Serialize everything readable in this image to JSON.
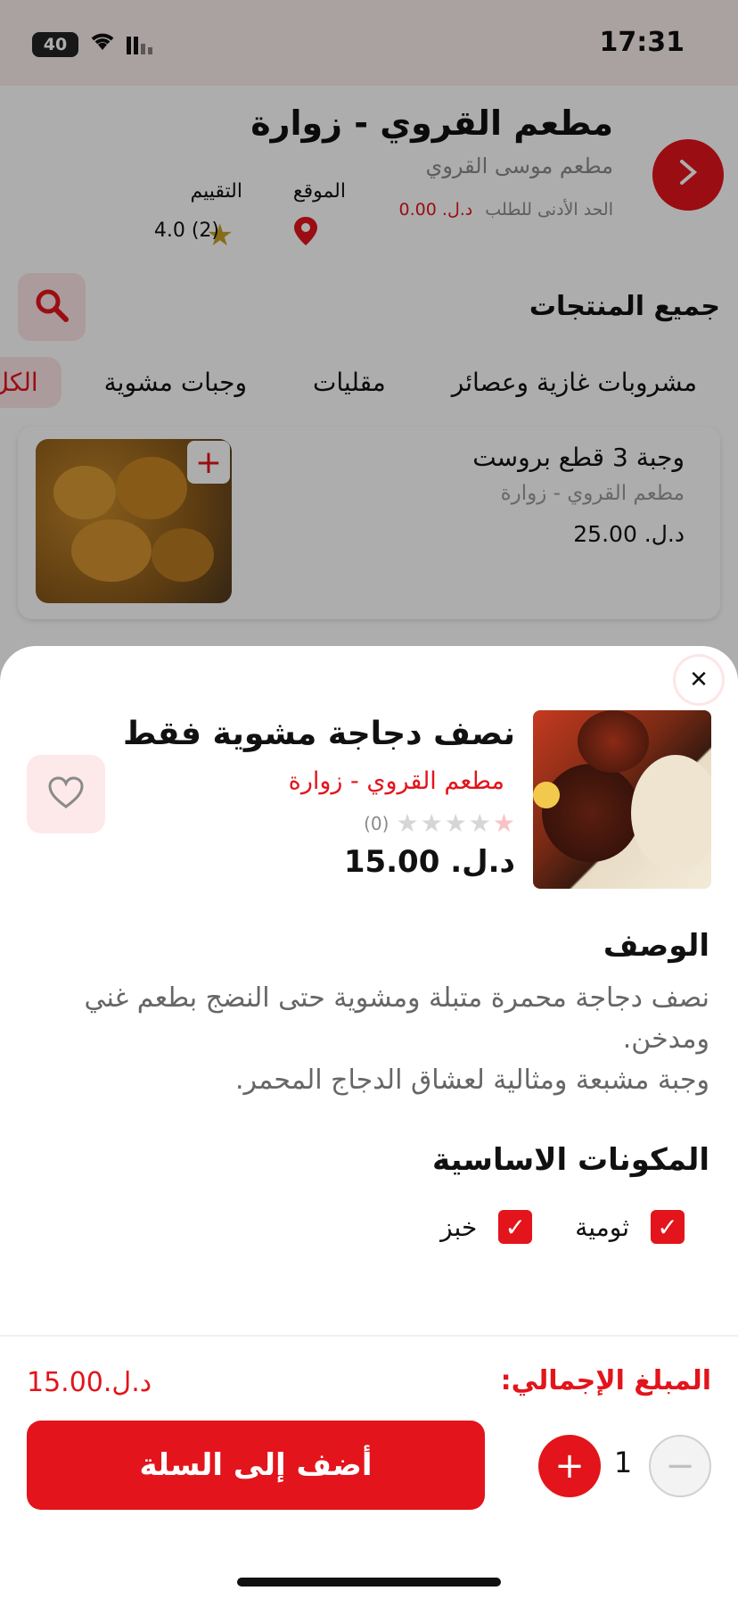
{
  "status_bar": {
    "time": "17:31",
    "battery": "40"
  },
  "restaurant": {
    "title": "مطعم القروي - زوارة",
    "subtitle": "مطعم موسى القروي",
    "min_order_label": "الحد الأدنى للطلب",
    "min_order_value": "د.ل. 0.00",
    "location_label": "الموقع",
    "rating_label": "التقييم",
    "rating_value": "4.0 (2)"
  },
  "products_heading": "جميع المنتجات",
  "categories": [
    "الكل",
    "وجبات مشوية",
    "مقليات",
    "مشروبات غازية وعصائر"
  ],
  "active_category": "الكل",
  "list_item": {
    "title": "وجبة 3 قطع بروست",
    "restaurant": "مطعم القروي - زوارة",
    "price": "د.ل. 25.00"
  },
  "product": {
    "title": "نصف دجاجة مشوية فقط",
    "restaurant": "مطعم القروي - زوارة",
    "rating_count": "(0)",
    "rating_value": 0,
    "price": "د.ل. 15.00",
    "description_title": "الوصف",
    "description": "نصف دجاجة محمرة متبلة ومشوية حتى النضج بطعم غني ومدخن.\nوجبة مشبعة ومثالية لعشاق الدجاج المحمر.",
    "ingredients_title": "المكونات الاساسية",
    "ingredients": [
      {
        "name": "ثومية",
        "checked": true
      },
      {
        "name": "خبز",
        "checked": true
      }
    ]
  },
  "cart": {
    "total_label": "المبلغ الإجمالي:",
    "total_value": "د.ل.15.00",
    "add_button": "أضف إلى السلة",
    "quantity": "1"
  },
  "colors": {
    "accent": "#e3141b",
    "accent_soft": "#fde5e6"
  }
}
